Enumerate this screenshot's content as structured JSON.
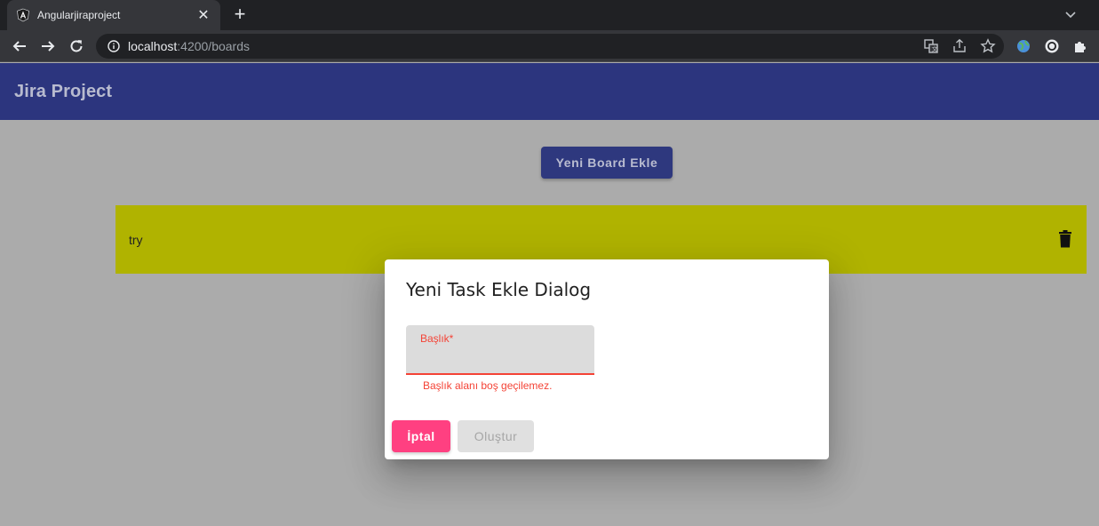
{
  "browser": {
    "tab_title": "Angularjiraproject",
    "url_host": "localhost",
    "url_rest": ":4200/boards"
  },
  "app": {
    "title": "Jira Project",
    "header_color": "#2c357e"
  },
  "page": {
    "add_board_label": "Yeni Board Ekle",
    "boards": [
      {
        "name": "try",
        "color": "#b0b300"
      }
    ]
  },
  "dialog": {
    "title": "Yeni Task Ekle Dialog",
    "field_label": "Başlık*",
    "field_value": "",
    "error_text": "Başlık alanı boş geçilemez.",
    "cancel_label": "İptal",
    "create_label": "Oluştur",
    "error_color": "#f44336",
    "accent_color": "#ff4081"
  }
}
